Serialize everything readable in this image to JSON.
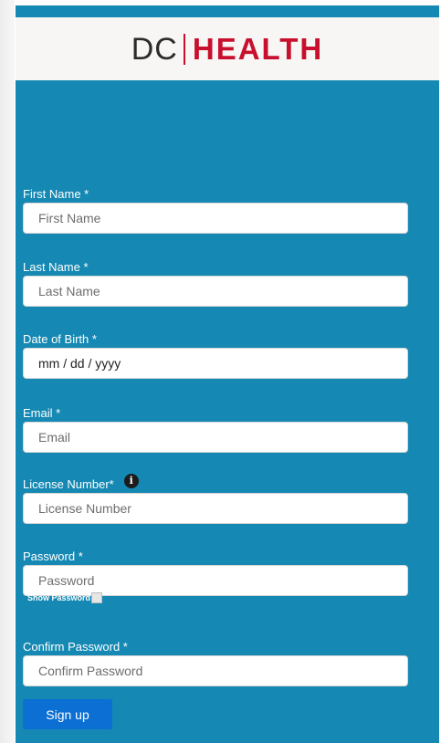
{
  "header": {
    "logo_dc": "DC",
    "logo_health": "HEALTH"
  },
  "form": {
    "first_name": {
      "label": "First Name *",
      "placeholder": "First Name"
    },
    "last_name": {
      "label": "Last Name *",
      "placeholder": "Last Name"
    },
    "dob": {
      "label": "Date of Birth *",
      "value": "mm / dd / yyyy"
    },
    "email": {
      "label": "Email *",
      "placeholder": "Email"
    },
    "license": {
      "label": "License Number*",
      "placeholder": "License Number",
      "info_icon": "info-icon"
    },
    "password": {
      "label": "Password *",
      "placeholder": "Password"
    },
    "show_password": {
      "label": "Show Password"
    },
    "confirm_password": {
      "label": "Confirm Password *",
      "placeholder": "Confirm Password"
    },
    "submit_label": "Sign up"
  },
  "colors": {
    "card_background": "#1589b3",
    "header_background": "#f7f6f4",
    "brand_red": "#c8102e",
    "button_blue": "#0b6fd3"
  }
}
